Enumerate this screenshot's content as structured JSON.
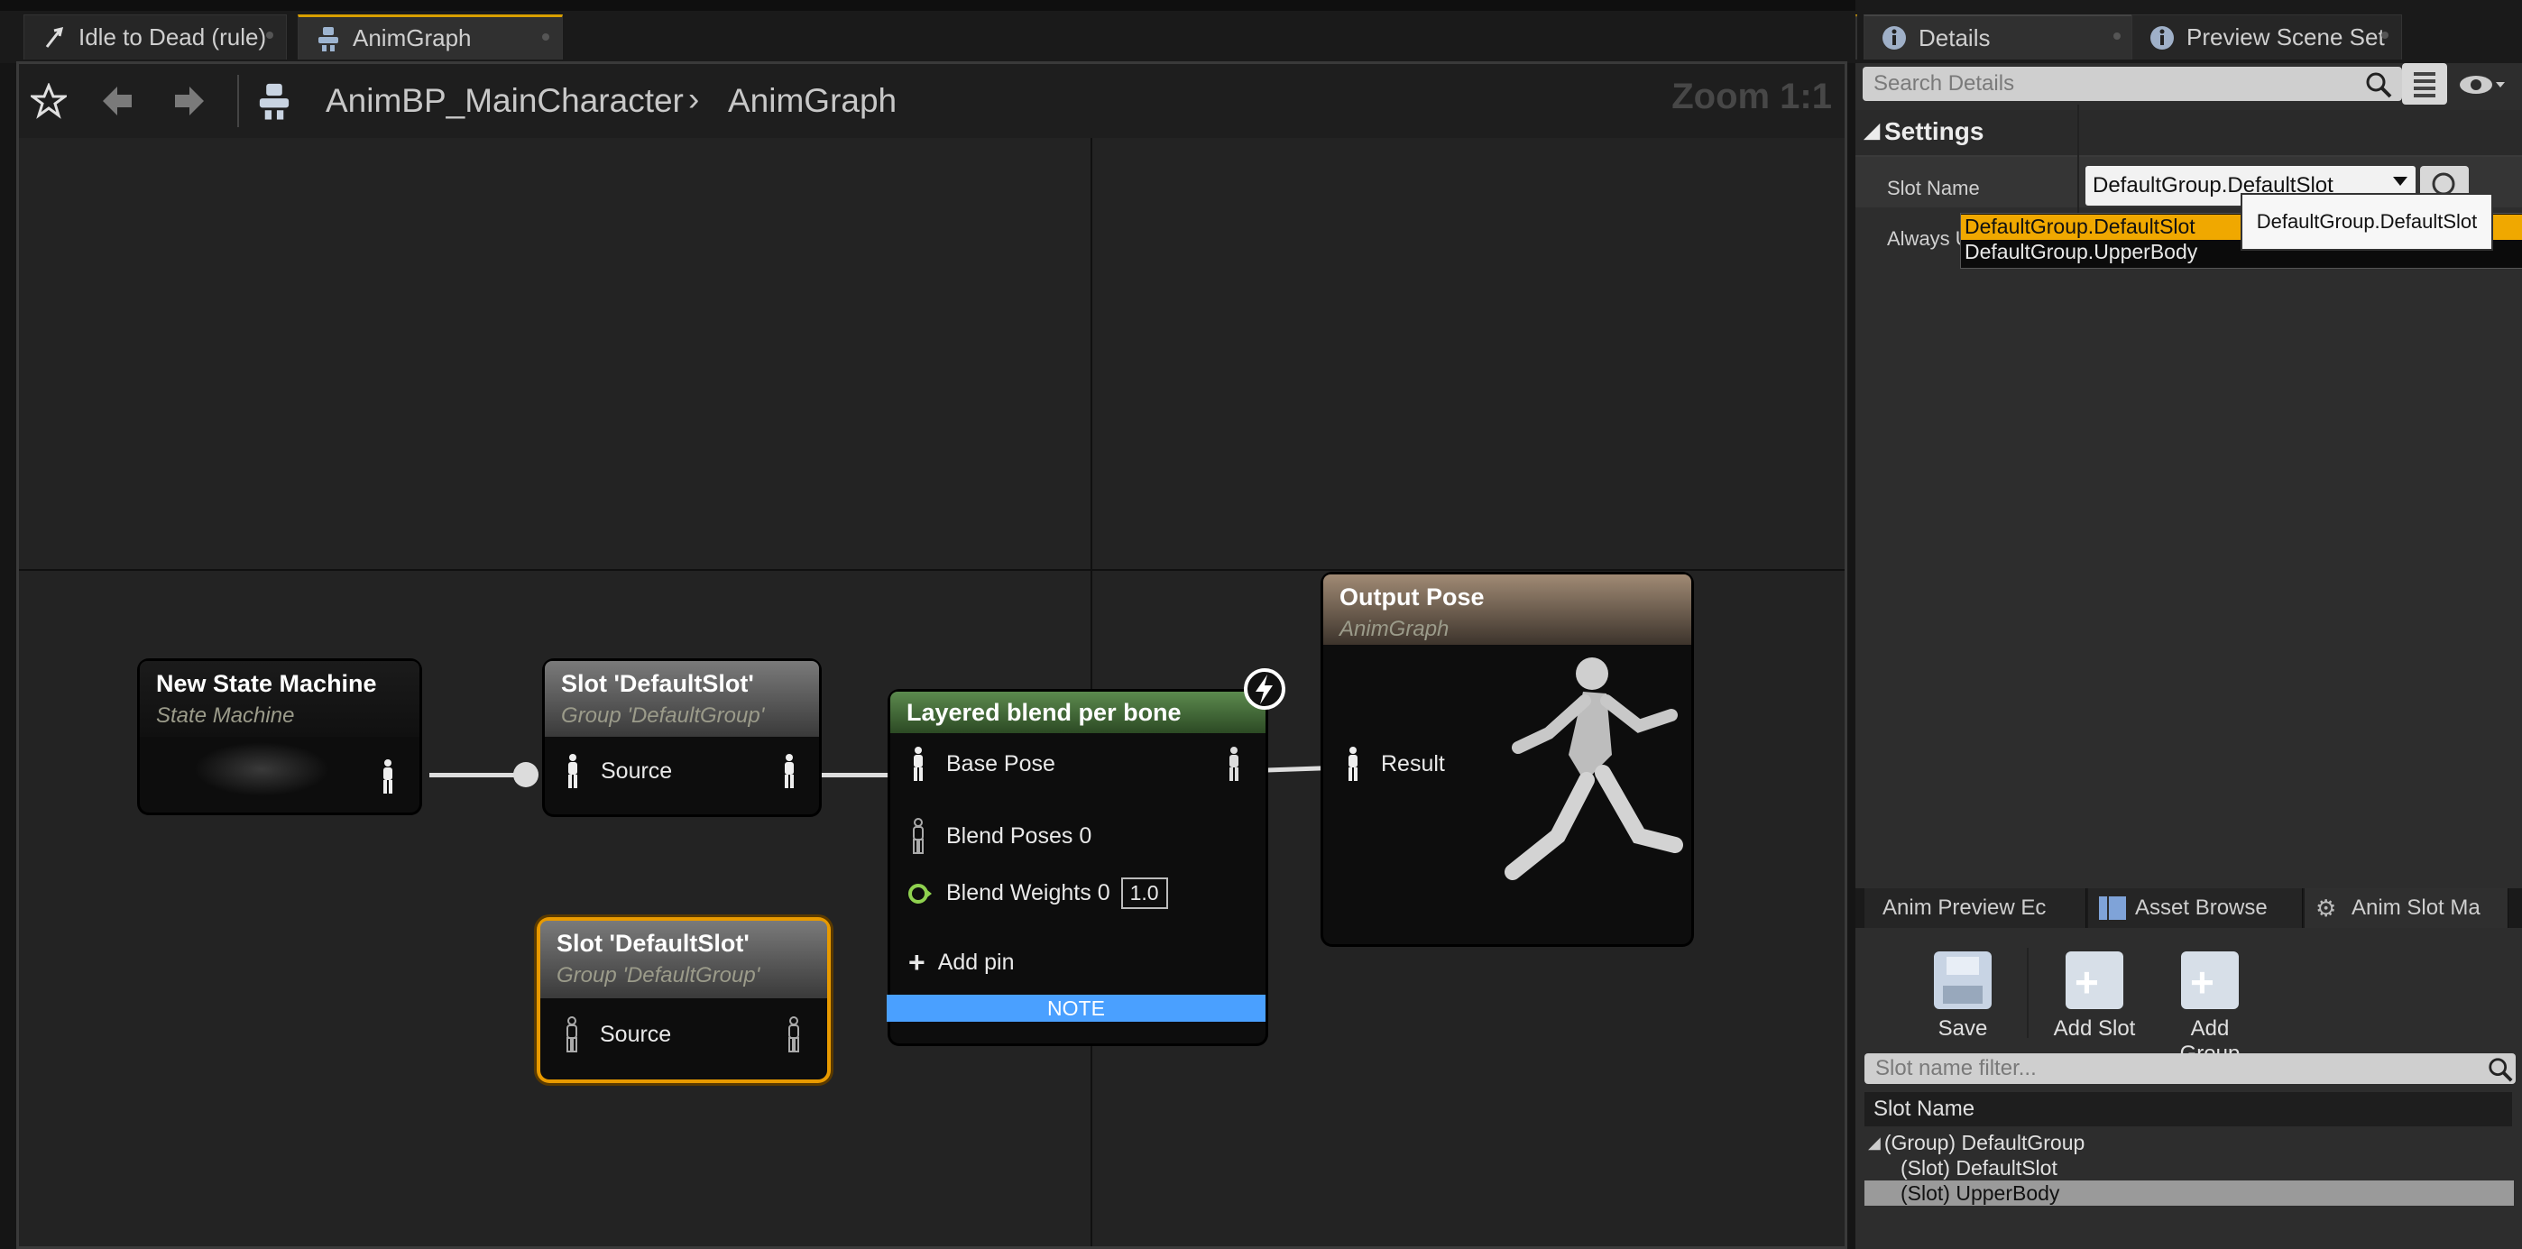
{
  "document_tabs": [
    {
      "label": "Idle to Dead (rule)",
      "icon": "transition-rule-icon"
    },
    {
      "label": "AnimGraph",
      "icon": "anim-graph-icon",
      "active": true
    }
  ],
  "graph": {
    "breadcrumb": [
      "AnimBP_MainCharacter",
      "AnimGraph"
    ],
    "zoom": "Zoom 1:1",
    "nodes": {
      "state_machine": {
        "title": "New State Machine",
        "subtitle": "State Machine"
      },
      "slot1": {
        "title": "Slot 'DefaultSlot'",
        "subtitle": "Group 'DefaultGroup'",
        "pin": "Source"
      },
      "layered": {
        "title": "Layered blend per bone",
        "base_pose": "Base Pose",
        "blend_poses": "Blend Poses 0",
        "blend_weights": "Blend Weights 0",
        "weight_value": "1.0",
        "add_pin": "Add pin",
        "note": "NOTE"
      },
      "output": {
        "title": "Output Pose",
        "subtitle": "AnimGraph",
        "pin": "Result"
      },
      "slot2": {
        "title": "Slot 'DefaultSlot'",
        "subtitle": "Group 'DefaultGroup'",
        "pin": "Source"
      }
    }
  },
  "details": {
    "tabs": [
      {
        "label": "Details",
        "icon": "info-icon",
        "active": true
      },
      {
        "label": "Preview Scene Set",
        "icon": "info-icon"
      }
    ],
    "search_placeholder": "Search Details",
    "section": "Settings",
    "slot_name_label": "Slot Name",
    "always_label": "Always U",
    "slot_name_value": "DefaultGroup.DefaultSlot",
    "dropdown_options": [
      "DefaultGroup.DefaultSlot",
      "DefaultGroup.UpperBody"
    ],
    "tooltip": "DefaultGroup.DefaultSlot",
    "highlight_color": "#f0a800"
  },
  "bottom": {
    "tabs": [
      "Anim Preview Ec",
      "Asset Browse",
      "Anim Slot Ma"
    ],
    "tools": [
      "Save",
      "Add Slot",
      "Add Group"
    ],
    "filter_placeholder": "Slot name filter...",
    "column_header": "Slot Name",
    "tree": [
      "(Group) DefaultGroup",
      "(Slot) DefaultSlot",
      "(Slot) UpperBody"
    ]
  }
}
